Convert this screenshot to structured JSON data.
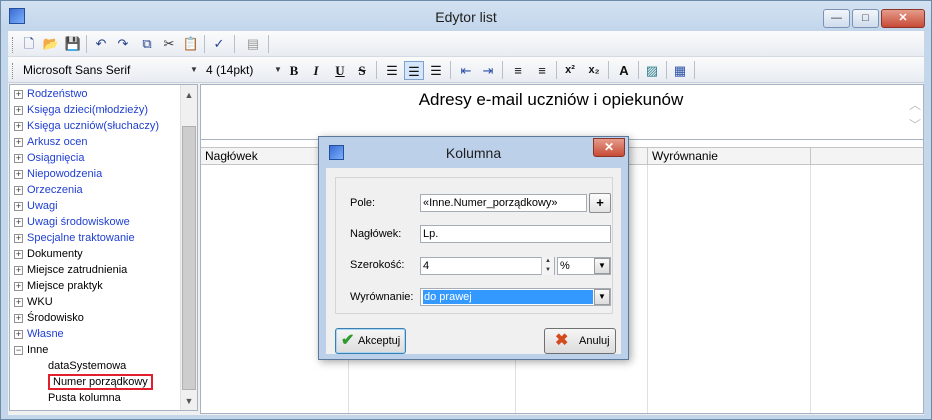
{
  "window": {
    "title": "Edytor list",
    "min_glyph": "—",
    "max_glyph": "□",
    "close_glyph": "✕"
  },
  "toolbar": {
    "font_name": "Microsoft Sans Serif",
    "font_size": "4 (14pkt)",
    "bold": "B",
    "italic": "I",
    "underline": "U",
    "strike": "S",
    "superscript": "x²",
    "subscript": "x₂",
    "font_icon": "A",
    "dropdown_glyph": "▼"
  },
  "tree": {
    "expand_glyph": "+",
    "collapse_glyph": "−",
    "items": [
      {
        "label": "Rodzeństwo",
        "color": "blue"
      },
      {
        "label": "Księga dzieci(młodzieży)",
        "color": "blue"
      },
      {
        "label": "Księga uczniów(słuchaczy)",
        "color": "blue"
      },
      {
        "label": "Arkusz ocen",
        "color": "blue"
      },
      {
        "label": "Osiągnięcia",
        "color": "blue"
      },
      {
        "label": "Niepowodzenia",
        "color": "blue"
      },
      {
        "label": "Orzeczenia",
        "color": "blue"
      },
      {
        "label": "Uwagi",
        "color": "blue"
      },
      {
        "label": "Uwagi środowiskowe",
        "color": "blue"
      },
      {
        "label": "Specjalne traktowanie",
        "color": "blue"
      },
      {
        "label": "Dokumenty",
        "color": "black"
      },
      {
        "label": "Miejsce zatrudnienia",
        "color": "black"
      },
      {
        "label": "Miejsce praktyk",
        "color": "black"
      },
      {
        "label": "WKU",
        "color": "black"
      },
      {
        "label": "Środowisko",
        "color": "black"
      },
      {
        "label": "Własne",
        "color": "blue"
      },
      {
        "label": "Inne",
        "color": "black"
      }
    ],
    "children": [
      "dataSystemowa",
      "Numer porządkowy",
      "Pusta kolumna"
    ],
    "selected_child": "Numer porządkowy"
  },
  "editor": {
    "heading": "Adresy e-mail uczniów i opiekunów",
    "columns": [
      "Nagłówek",
      "",
      "",
      "Wyrównanie"
    ]
  },
  "dialog": {
    "title": "Kolumna",
    "close_glyph": "✕",
    "field_label": "Pole:",
    "field_value": "«Inne.Numer_porządkowy»",
    "header_label": "Nagłówek:",
    "header_value": "Lp.",
    "width_label": "Szerokość:",
    "width_value": "4",
    "width_unit": "%",
    "align_label": "Wyrównanie:",
    "align_value": "do prawej",
    "accept_label": "Akceptuj",
    "cancel_label": "Anuluj",
    "plus_glyph": "+",
    "spin_up": "▲",
    "spin_down": "▼",
    "dropdown_glyph": "▼"
  }
}
